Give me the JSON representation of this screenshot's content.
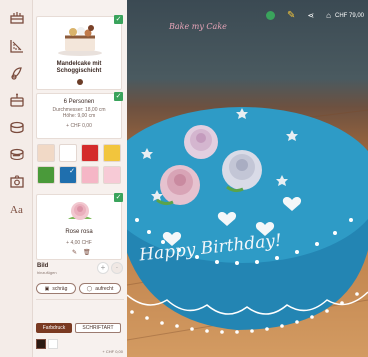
{
  "brand": {
    "logo_text": "Bake my Cake"
  },
  "toolbar": {
    "cart_price": "CHF 79,00",
    "icons": [
      "check-icon",
      "pencil-icon",
      "share-icon",
      "cart-icon"
    ]
  },
  "rail": {
    "icons": [
      "cake-shape-icon",
      "ruler-icon",
      "flavor-icon",
      "layer-icon",
      "cream-icon",
      "decoration-icon",
      "photo-icon",
      "text-icon"
    ]
  },
  "panel": {
    "cake_card": {
      "name": "Mandelcake mit Schoggischicht",
      "detail": "Mandel und Schoggi"
    },
    "size_card": {
      "persons": "6 Personen",
      "diameter": "Durchmesser: 18,00 cm",
      "height": "Höhe: 9,00 cm",
      "price": "+ CHF 0,00"
    },
    "colors": [
      "#f1d9c6",
      "#ffffff",
      "#d42b2b",
      "#f2c53d",
      "#4a9a3a",
      "#1f6fae",
      "#f5b6c6",
      "#f7cad6"
    ],
    "decoration_card": {
      "name": "Rose rosa",
      "price": "+ 4,00 CHF"
    },
    "bild": {
      "label": "Bild",
      "sub": "hinzufügen"
    },
    "orientation": {
      "opt1": "schräg",
      "opt2": "aufrecht"
    },
    "tabs": {
      "tab1": "Farbdruck",
      "tab2": "SCHRIFTART"
    },
    "footer_price": "+ CHF 0,00"
  },
  "cake": {
    "message": "Happy Birthday!",
    "main_color": "#2e9bc6"
  }
}
